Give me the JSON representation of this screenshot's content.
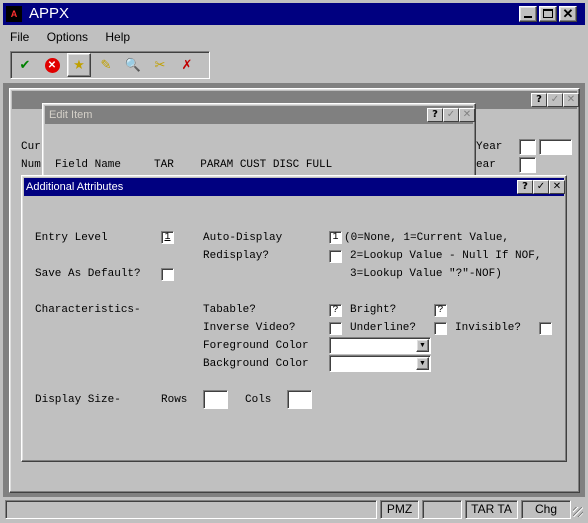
{
  "app": {
    "title": "APPX",
    "icon_text": "A"
  },
  "menu": [
    "File",
    "Options",
    "Help"
  ],
  "toolbar": [
    "check-doc-icon",
    "cancel-icon",
    "folder-star-icon",
    "folder-edit-icon",
    "folder-search-icon",
    "folder-cut-icon",
    "folder-delete-icon"
  ],
  "bg_form": {
    "left_fragments": [
      "Cur",
      "Num"
    ],
    "right_labels": [
      "Year",
      "ear"
    ]
  },
  "edit_item": {
    "title": "Edit Item",
    "header": "Field Name     TAR    PARAM CUST DISC FULL"
  },
  "dialog": {
    "title": "Additional Attributes",
    "entry_level": {
      "label": "Entry Level",
      "value": "1"
    },
    "save_default": {
      "label": "Save As Default?",
      "value": ""
    },
    "auto_display": {
      "label": "Auto-Display",
      "value": "1",
      "hint1": "(0=None, 1=Current Value,",
      "hint2": "2=Lookup Value - Null If NOF,",
      "hint3": "3=Lookup Value \"?\"-NOF)"
    },
    "redisplay": {
      "label": "Redisplay?",
      "value": ""
    },
    "characteristics": "Characteristics-",
    "tabable": {
      "label": "Tabable?",
      "value": "?"
    },
    "bright": {
      "label": "Bright?",
      "value": "?"
    },
    "inverse": {
      "label": "Inverse Video?",
      "value": ""
    },
    "underline": {
      "label": "Underline?",
      "value": ""
    },
    "invisible": {
      "label": "Invisible?",
      "value": ""
    },
    "fg_color": {
      "label": "Foreground Color",
      "value": ""
    },
    "bg_color": {
      "label": "Background Color",
      "value": ""
    },
    "display_size": {
      "label": "Display Size-",
      "rows_label": "Rows",
      "rows_value": "",
      "cols_label": "Cols",
      "cols_value": ""
    }
  },
  "status": [
    "PMZ",
    "",
    "TAR TA",
    "Chg"
  ],
  "colors": {
    "title_active": "#000080",
    "title_inactive": "#808080"
  }
}
